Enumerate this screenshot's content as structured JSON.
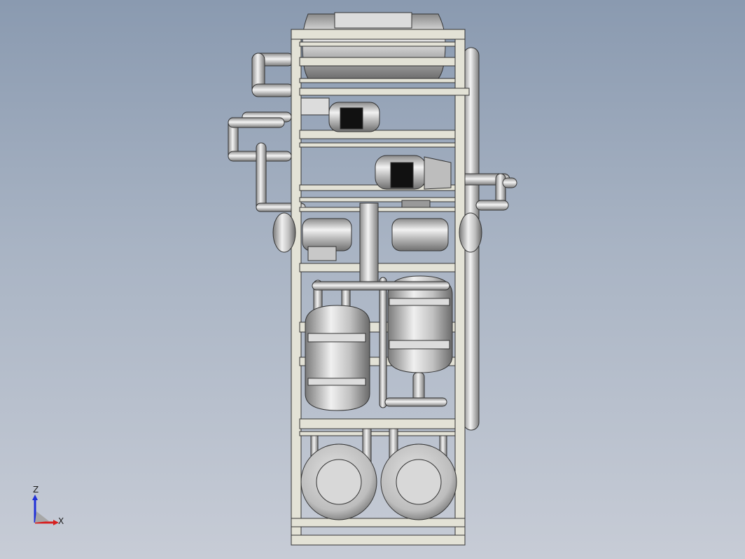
{
  "viewport": {
    "background_top": "#8a9ab0",
    "background_bottom": "#c7ccd6"
  },
  "model": {
    "frame_color": "#e3e2d6",
    "metal_color": "#c9c9c9",
    "motor_window_color": "#111111"
  },
  "triad": {
    "x_label": "X",
    "y_label": "",
    "z_label": "Z",
    "x_color": "#d62020",
    "z_color": "#2030d8"
  }
}
